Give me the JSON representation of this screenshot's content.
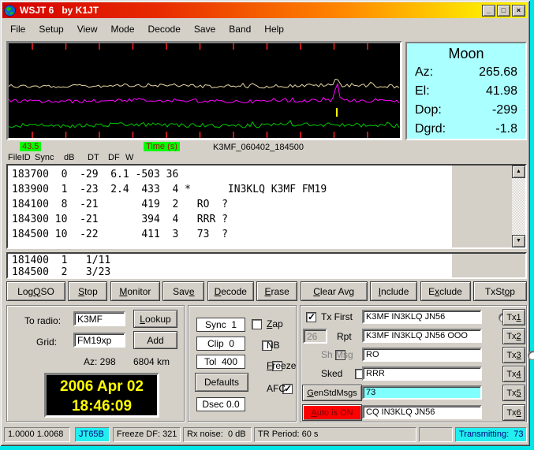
{
  "window": {
    "title": "WSJT 6   by K1JT"
  },
  "menu": [
    "File",
    "Setup",
    "View",
    "Mode",
    "Decode",
    "Save",
    "Band",
    "Help"
  ],
  "moon": {
    "title": "Moon",
    "az_label": "Az:",
    "az_value": "265.68",
    "el_label": "El:",
    "el_value": "41.98",
    "dop_label": "Dop:",
    "dop_value": "-299",
    "dgrd_label": "Dgrd:",
    "dgrd_value": "-1.8"
  },
  "graph": {
    "left_label": "43.5",
    "axis_label": "Time (s)",
    "file_label": "K3MF_060402_184500"
  },
  "decode": {
    "headers": [
      "FileID",
      "Sync",
      "dB",
      "DT",
      "DF",
      "W"
    ],
    "lines": [
      "183700  0  -29  6.1 -503 36",
      "183900  1  -23  2.4  433  4 *      IN3KLQ K3MF FM19",
      "184100  8  -21       419  2   RO  ?",
      "184300 10  -21       394  4   RRR ?",
      "184500 10  -22       411  3   73  ?"
    ],
    "avg_lines": [
      "181400  1   1/11",
      "184500  2   3/23"
    ]
  },
  "action_buttons": [
    {
      "label": "Log QSO",
      "u": 4
    },
    {
      "label": "Stop",
      "u": 0
    },
    {
      "label": "Monitor",
      "u": 0
    },
    {
      "label": "Save",
      "u": 3
    },
    {
      "label": "Decode",
      "u": 0
    },
    {
      "label": "Erase",
      "u": 0
    },
    {
      "label": "Clear Avg",
      "u": 0
    },
    {
      "label": "Include",
      "u": 0
    },
    {
      "label": "Exclude",
      "u": 1
    },
    {
      "label": "TxStop",
      "u": 4
    }
  ],
  "station": {
    "to_radio_label": "To radio:",
    "to_radio_value": "K3MF",
    "lookup_label": "Lookup",
    "grid_label": "Grid:",
    "grid_value": "FM19xp",
    "add_label": "Add",
    "az": "Az: 298",
    "distance": "6804 km",
    "clock_date": "2006 Apr 02",
    "clock_time": "18:46:09"
  },
  "params": {
    "sync": "Sync  1",
    "clip": "Clip  0",
    "tol": "Tol  400",
    "defaults_label": "Defaults",
    "dsec": "Dsec 0.0",
    "checkboxes": [
      {
        "label": "Zap",
        "u": 0,
        "checked": false
      },
      {
        "label": "NB",
        "checked": false
      },
      {
        "label": "Freeze",
        "u": 0,
        "checked": false
      },
      {
        "label": "AFC",
        "checked": true
      }
    ]
  },
  "tx": {
    "rows": [
      {
        "kind": "checkbox",
        "label": "Tx First",
        "checked": true,
        "disabled": false,
        "message": "K3MF IN3KLQ JN56",
        "highlight": false,
        "button": "Tx1",
        "button_u": 2,
        "selected": false
      },
      {
        "kind": "rpt",
        "label": "Rpt",
        "rpt_value": "26",
        "message": "K3MF IN3KLQ JN56 OOO",
        "highlight": false,
        "button": "Tx2",
        "button_u": 2,
        "selected": false
      },
      {
        "kind": "checkbox",
        "label": "Sh Msg",
        "checked": false,
        "disabled": true,
        "message": "RO",
        "highlight": false,
        "button": "Tx3",
        "button_u": 2,
        "selected": false
      },
      {
        "kind": "checkbox",
        "label": "Sked",
        "checked": false,
        "disabled": false,
        "message": "RRR",
        "highlight": false,
        "button": "Tx4",
        "button_u": 2,
        "selected": false
      },
      {
        "kind": "button",
        "label": "GenStdMsgs",
        "u": 0,
        "message": "73",
        "highlight": true,
        "button": "Tx5",
        "button_u": 2,
        "selected": true
      },
      {
        "kind": "button-red",
        "label": "Auto is ON",
        "u": 0,
        "message": "CQ IN3KLQ JN56",
        "highlight": false,
        "button": "Tx6",
        "button_u": 2,
        "selected": false
      }
    ]
  },
  "status": [
    {
      "name": "sample-factor",
      "text": "1.0000 1.0068",
      "highlight": false
    },
    {
      "name": "mode",
      "text": "JT65B",
      "highlight": true
    },
    {
      "name": "freeze-df",
      "text": "Freeze DF: 321",
      "highlight": false
    },
    {
      "name": "rx-noise",
      "text": "Rx noise:  0 dB",
      "highlight": false
    },
    {
      "name": "tr-period",
      "text": "TR Period: 60 s",
      "highlight": false
    },
    {
      "name": "spacer",
      "text": "",
      "highlight": false
    },
    {
      "name": "transmitting",
      "text": "Transmitting:  73",
      "highlight": true
    }
  ],
  "colors": {
    "moon_bg": "#aaffff",
    "green_label_bg": "#00ff00",
    "green_label_text": "#a01010",
    "clock_text": "#ffff00",
    "auto_on_bg": "#ff0000",
    "auto_on_text": "#7c0000",
    "tx5_highlight_bg": "#80ffff",
    "trace_top": "#e6d7a3",
    "trace_mid": "#ff00ff",
    "trace_bottom": "#00c800",
    "tick": "#ff2020",
    "marker": "#ffff00"
  }
}
